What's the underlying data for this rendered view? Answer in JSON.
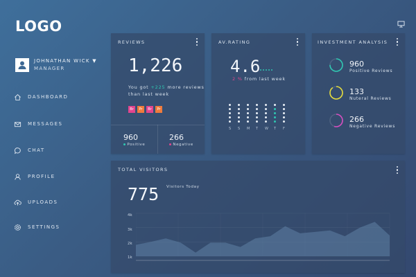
{
  "sidebar": {
    "logo": "LOGO",
    "user": {
      "name": "JOHNATHAN WICK ▼",
      "role": "MANAGER"
    },
    "items": [
      {
        "label": "DASHBOARD",
        "icon": "home-icon"
      },
      {
        "label": "MESSAGES",
        "icon": "envelope-icon"
      },
      {
        "label": "CHAT",
        "icon": "chat-bubble-icon"
      },
      {
        "label": "PROFILE",
        "icon": "user-icon"
      },
      {
        "label": "UPLOADS",
        "icon": "cloud-upload-icon"
      },
      {
        "label": "SETTINGS",
        "icon": "gear-icon"
      }
    ]
  },
  "header": {
    "icon": "monitor-icon"
  },
  "reviews": {
    "title": "REVIEWS",
    "value": "1,226",
    "note_prefix": "You got",
    "note_highlight": "+225",
    "note_suffix": "more reviews",
    "note_line2": "than last week",
    "tags": [
      {
        "text": "Br",
        "color": "#e2458e"
      },
      {
        "text": "Pr",
        "color": "#ef7b3c"
      },
      {
        "text": "Br",
        "color": "#e2458e"
      },
      {
        "text": "Pr",
        "color": "#ef7b3c"
      }
    ],
    "positive_value": "960",
    "positive_label": "Positive",
    "negative_value": "266",
    "negative_label": "Negative",
    "positive_color": "#2fc7b1",
    "negative_color": "#e2458e"
  },
  "rating": {
    "title": "AV.RATING",
    "value": "4.6",
    "change": "2 %",
    "change_suffix": "from last week",
    "change_color": "#e2458e",
    "accent": "#2fc7b1",
    "days": [
      "S",
      "S",
      "M",
      "T",
      "W",
      "T",
      "F"
    ],
    "highlighted_day_index": 5
  },
  "investment": {
    "title": "INVESTMENT ANALYSIS",
    "items": [
      {
        "value": "960",
        "label": "Positive Reviews",
        "color": "#2fc7b1",
        "fraction": 0.75
      },
      {
        "value": "133",
        "label": "Nuteral Reviews",
        "color": "#e5dc3c",
        "fraction": 0.9
      },
      {
        "value": "266",
        "label": "Negative Reviews",
        "color": "#d64ec0",
        "fraction": 0.55
      }
    ]
  },
  "visitors": {
    "title": "TOTAL VISITORS",
    "value": "775",
    "value_label": "Visitors Today"
  },
  "chart_data": {
    "type": "area",
    "title": "",
    "xlabel": "",
    "ylabel": "",
    "y_ticks": [
      "4k",
      "3k",
      "2k",
      "1k"
    ],
    "ylim": [
      1000,
      4000
    ],
    "x": [
      0,
      1,
      2,
      3,
      4,
      5,
      6,
      7,
      8,
      9,
      10,
      11,
      12,
      13,
      14,
      15,
      16
    ],
    "values": [
      1800,
      2000,
      2250,
      1950,
      1250,
      1950,
      1950,
      1650,
      2250,
      2400,
      3100,
      2600,
      2700,
      2800,
      2400,
      3000,
      3400,
      2450
    ],
    "grid": true
  }
}
